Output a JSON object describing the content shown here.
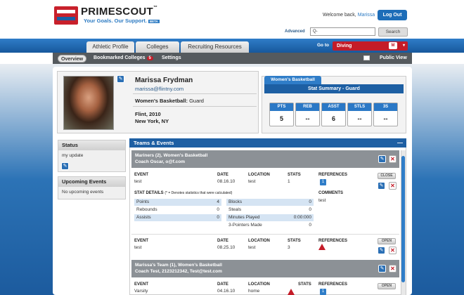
{
  "header": {
    "brand": "PRIMESCOUT",
    "tm": "™",
    "tagline": "Your Goals. Our Support.",
    "beta": "BETA",
    "welcome_prefix": "Welcome back,",
    "user": "Marissa",
    "logout_label": "Log Out"
  },
  "search": {
    "advanced_label": "Advanced",
    "placeholder": "Q-",
    "button_label": "Search"
  },
  "nav": {
    "tabs": [
      {
        "label": "Athletic Profile"
      },
      {
        "label": "Colleges"
      },
      {
        "label": "Recruiting Resources"
      }
    ],
    "goto_label": "Go to",
    "goto_value": "Diving",
    "goto_badge": "M"
  },
  "subnav": {
    "overview": "Overview",
    "bookmarked": "Bookmarked Colleges",
    "bookmarked_count": "5",
    "settings": "Settings",
    "public_view": "Public View"
  },
  "profile": {
    "name": "Marissa Frydman",
    "email": "marissa@flintny.com",
    "sport_label": "Women's Basketball:",
    "sport_position": "Guard",
    "school": "Flint, 2010",
    "location": "New York, NY"
  },
  "stats": {
    "tab": "Women's Basketball",
    "title": "Stat Summary - Guard",
    "items": [
      {
        "label": "PTS",
        "value": "5"
      },
      {
        "label": "REB",
        "value": "--"
      },
      {
        "label": "ASST",
        "value": "6"
      },
      {
        "label": "STLS",
        "value": "--"
      },
      {
        "label": "3S",
        "value": "--"
      }
    ]
  },
  "sidebar": {
    "status_title": "Status",
    "status_text": "my update",
    "events_title": "Upcoming Events",
    "events_text": "No upcoming events"
  },
  "teams": {
    "title": "Teams & Events",
    "minimize": "—",
    "team1_name": "Mariners (2), Women's Basketball",
    "team1_coach": "Coach Oscar, o@f.com",
    "team2_name": "Marissa's Team (1), Women's Basketball",
    "team2_coach": "Coach Test, 2123212342, Test@test.com",
    "headers": {
      "event": "EVENT",
      "date": "DATE",
      "location": "LOCATION",
      "stats": "STATS",
      "references": "REFERENCES",
      "comments": "COMMENTS"
    },
    "events": [
      {
        "event": "test",
        "date": "08.16.10",
        "location": "test",
        "stats": "1",
        "ref": "1",
        "btn": "CLOSE",
        "comments": "test"
      },
      {
        "event": "test",
        "date": "08.25.10",
        "location": "test",
        "stats": "3",
        "btn": "OPEN"
      },
      {
        "event": "Varsity",
        "date": "04.16.10",
        "location": "home",
        "ref": "1",
        "btn": "OPEN"
      }
    ],
    "stat_details_label": "STAT DETAILS",
    "stat_details_note": "(* = Denotes statistics that were calculated)",
    "details_left": [
      {
        "label": "Points",
        "value": "4"
      },
      {
        "label": "Rebounds",
        "value": "0"
      },
      {
        "label": "Assists",
        "value": "0"
      }
    ],
    "details_right": [
      {
        "label": "Blocks",
        "value": "0"
      },
      {
        "label": "Steals",
        "value": "0"
      },
      {
        "label": "Minutes Played",
        "value": "0:00:000"
      },
      {
        "label": "3-Pointers Made",
        "value": "0"
      }
    ]
  }
}
